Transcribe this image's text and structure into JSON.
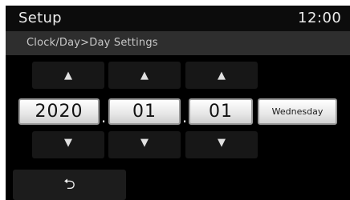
{
  "header": {
    "title": "Setup",
    "time": "12:00"
  },
  "breadcrumb": "Clock/Day>Day Settings",
  "date": {
    "year": "2020",
    "month": "01",
    "day": "01",
    "separator": ".",
    "weekday": "Wednesday"
  },
  "icons": {
    "up": "▲",
    "down": "▼",
    "back": "⮌"
  }
}
